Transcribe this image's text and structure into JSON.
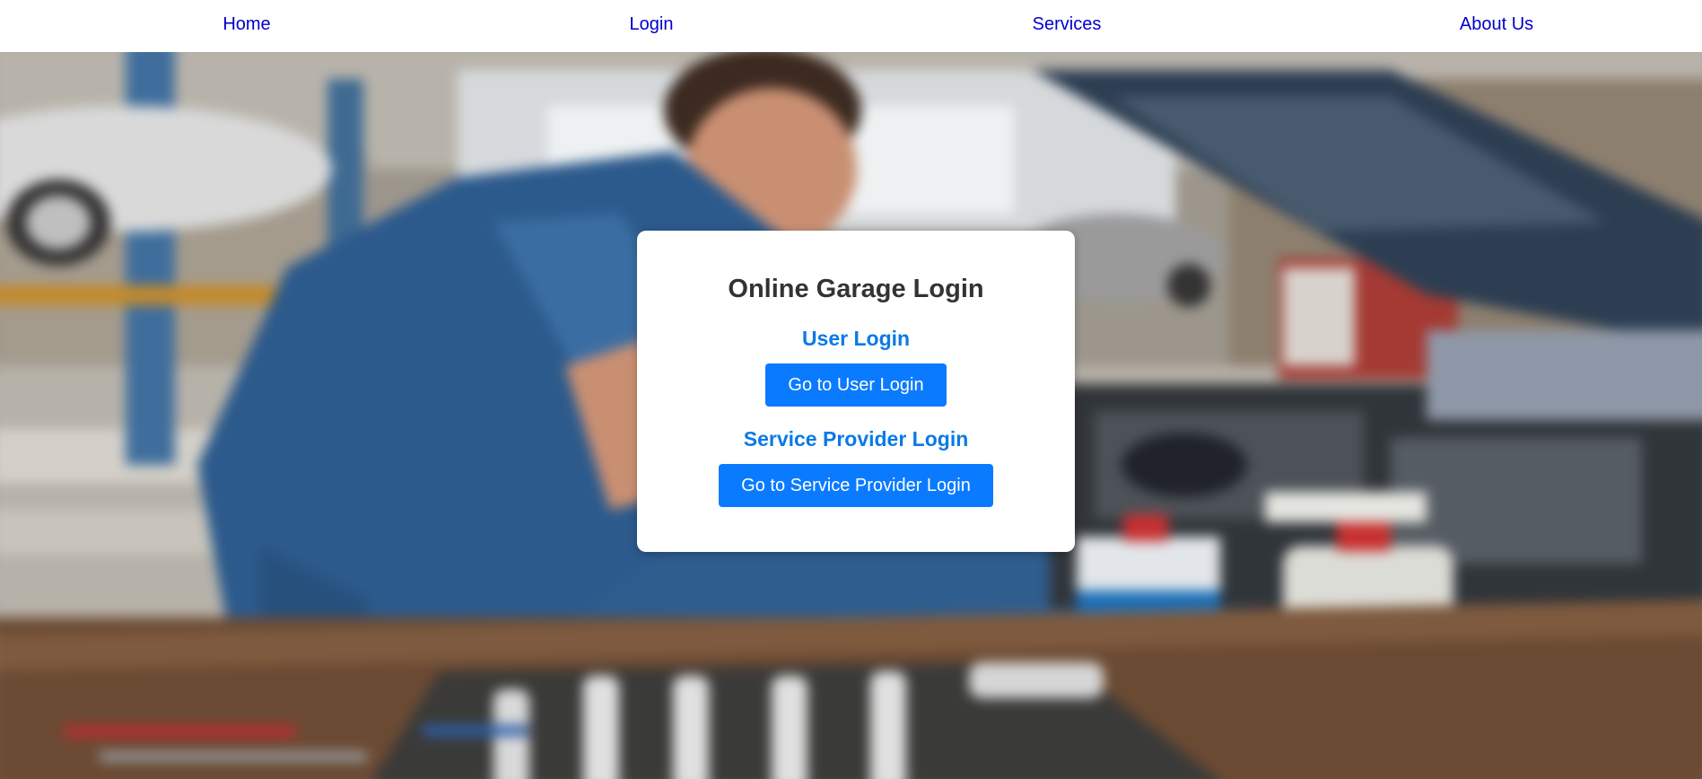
{
  "nav": {
    "home": "Home",
    "login": "Login",
    "services": "Services",
    "about": "About Us"
  },
  "card": {
    "title": "Online Garage Login",
    "user_section_title": "User Login",
    "user_button": "Go to User Login",
    "provider_section_title": "Service Provider Login",
    "provider_button": "Go to Service Provider Login"
  },
  "colors": {
    "nav_link": "#0000cc",
    "accent": "#0a7bff",
    "section_title": "#0a7ae6",
    "card_title": "#333333"
  }
}
